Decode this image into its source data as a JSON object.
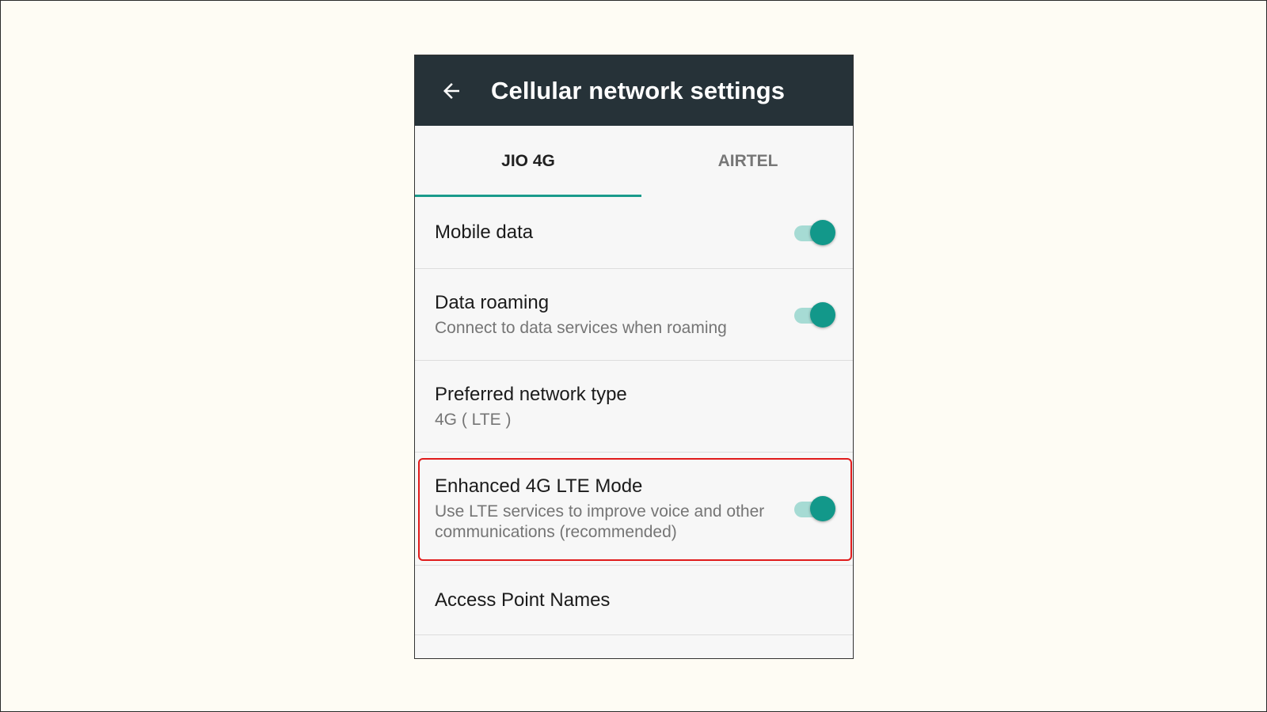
{
  "appbar": {
    "title": "Cellular network settings",
    "back_icon": "arrow-left-icon",
    "background": "#263238"
  },
  "tabs": [
    {
      "label": "JIO 4G",
      "selected": true
    },
    {
      "label": "AIRTEL",
      "selected": false
    }
  ],
  "accent_color": "#1a9b8c",
  "settings": [
    {
      "title": "Mobile data",
      "toggle": true
    },
    {
      "title": "Data roaming",
      "subtitle": "Connect to data services when roaming",
      "toggle": true
    },
    {
      "title": "Preferred network type",
      "subtitle": "4G ( LTE )"
    },
    {
      "title": "Enhanced 4G LTE Mode",
      "subtitle": "Use LTE services to improve voice and other communications (recommended)",
      "toggle": true,
      "highlighted": true
    },
    {
      "title": "Access Point Names"
    }
  ],
  "highlight_color": "#e01b1b"
}
